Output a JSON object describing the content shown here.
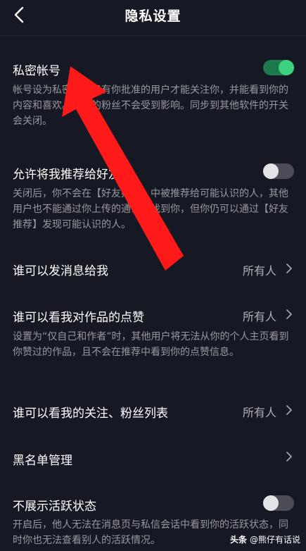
{
  "header": {
    "title": "隐私设置"
  },
  "private_account": {
    "title": "私密帐号",
    "desc": "帐号设为私密时，只有你批准的用户才能关注你，并能看到你的内容和喜欢。现有的粉丝不会受到影响。同步到其他软件的开关会关闭。",
    "enabled": true
  },
  "recommend": {
    "title": "允许将我推荐给好友",
    "desc": "关闭后，你不会在【好友推荐】中被推荐给可能认识的人，其他用户也不能通过你上传的通讯录找到你，但你仍可以通过【好友推荐】发现可能认识的人。",
    "enabled": false
  },
  "message": {
    "title": "谁可以发消息给我",
    "value": "所有人"
  },
  "likes": {
    "title": "谁可以看我对作品的点赞",
    "value": "所有人",
    "desc": "设置为“仅自己和作者”时，其他用户将无法从你的个人主页看到你赞过的作品，且不会在推荐中看到你的点赞信息。"
  },
  "follow_list": {
    "title": "谁可以看我的关注、粉丝列表",
    "value": "所有人"
  },
  "blacklist": {
    "title": "黑名单管理"
  },
  "activity": {
    "title": "不展示活跃状态",
    "desc": "开启后，他人无法在消息页与私信会话中看到你的活跃状态，同时你也无法查看别人的活跃情况。",
    "enabled": false
  },
  "watermark": {
    "brand": "头条",
    "account": "@熊仔有话说"
  },
  "colors": {
    "background": "#161823",
    "toggle_on": "#3bd17f",
    "arrow": "#ff1a1a"
  }
}
